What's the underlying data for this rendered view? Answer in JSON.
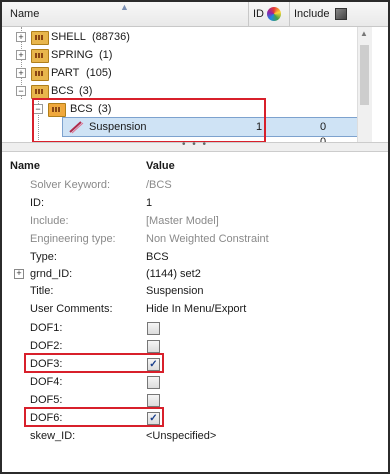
{
  "tree": {
    "headers": {
      "name": "Name",
      "id": "ID",
      "include": "Include"
    },
    "rows": [
      {
        "label": "SHELL",
        "count": "(88736)"
      },
      {
        "label": "SPRING",
        "count": "(1)"
      },
      {
        "label": "PART",
        "count": "(105)"
      },
      {
        "label": "BCS",
        "count": "(3)"
      }
    ],
    "child": {
      "label": "BCS",
      "count": "(3)"
    },
    "selected": {
      "label": "Suspension",
      "id": "1",
      "include": "0"
    },
    "partial_value": "0",
    "splitter_dots": "• • •"
  },
  "properties": {
    "headers": {
      "name": "Name",
      "value": "Value"
    },
    "rows": [
      {
        "name": "Solver Keyword:",
        "value": "/BCS"
      },
      {
        "name": "ID:",
        "value": "1"
      },
      {
        "name": "Include:",
        "value": "[Master Model]"
      },
      {
        "name": "Engineering type:",
        "value": "Non Weighted Constraint"
      },
      {
        "name": "Type:",
        "value": "BCS"
      },
      {
        "name": "grnd_ID:",
        "value": "(1144) set2"
      },
      {
        "name": "Title:",
        "value": "Suspension"
      },
      {
        "name": "User Comments:",
        "value": "Hide In Menu/Export"
      },
      {
        "name": "DOF1:"
      },
      {
        "name": "DOF2:"
      },
      {
        "name": "DOF3:"
      },
      {
        "name": "DOF4:"
      },
      {
        "name": "DOF5:"
      },
      {
        "name": "DOF6:"
      },
      {
        "name": "skew_ID:",
        "value": "<Unspecified>"
      }
    ],
    "checks": {
      "DOF1": false,
      "DOF2": false,
      "DOF3": true,
      "DOF4": false,
      "DOF5": false,
      "DOF6": true
    },
    "check_mark": "✓",
    "expander": "+"
  },
  "colors": {
    "highlight": "#d8202b",
    "selection": "#cfe3f5"
  }
}
